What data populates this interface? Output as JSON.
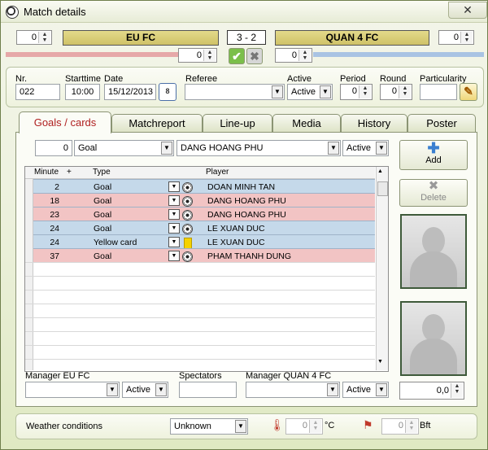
{
  "window": {
    "title": "Match details",
    "close_glyph": "✕"
  },
  "score": {
    "home_extra": "0",
    "home_team": "EU FC",
    "score_display": "3 - 2",
    "away_team": "QUAN 4 FC",
    "away_extra": "0",
    "home_goals": "0",
    "away_goals": "0"
  },
  "match_info": {
    "nr_label": "Nr.",
    "nr_value": "022",
    "starttime_label": "Starttime",
    "starttime_value": "10:00",
    "date_label": "Date",
    "date_value": "15/12/2013",
    "calendar_glyph": "8",
    "referee_label": "Referee",
    "referee_value": "",
    "active_label": "Active",
    "active_value": "Active",
    "period_label": "Period",
    "period_value": "0",
    "round_label": "Round",
    "round_value": "0",
    "particularity_label": "Particularity",
    "particularity_value": ""
  },
  "tabs": [
    "Goals / cards",
    "Matchreport",
    "Line-up",
    "Media",
    "History",
    "Poster"
  ],
  "goals": {
    "filter": {
      "minute": "0",
      "type": "Goal",
      "player": "DANG HOANG PHU",
      "status": "Active"
    },
    "headers": {
      "minute": "Minute",
      "plus": "+",
      "type": "Type",
      "player": "Player"
    },
    "rows": [
      {
        "minute": "2",
        "type": "Goal",
        "player": "DOAN MINH TAN",
        "team": "away",
        "icon": "ball-icon"
      },
      {
        "minute": "18",
        "type": "Goal",
        "player": "DANG HOANG PHU",
        "team": "home",
        "icon": "ball-icon"
      },
      {
        "minute": "23",
        "type": "Goal",
        "player": "DANG HOANG PHU",
        "team": "home",
        "icon": "ball-icon"
      },
      {
        "minute": "24",
        "type": "Goal",
        "player": "LE XUAN DUC",
        "team": "away",
        "icon": "ball-icon"
      },
      {
        "minute": "24",
        "type": "Yellow card",
        "player": "LE XUAN DUC",
        "team": "away",
        "icon": "yellow-card-icon"
      },
      {
        "minute": "37",
        "type": "Goal",
        "player": "PHAM THANH DUNG",
        "team": "home",
        "icon": "ball-icon"
      }
    ],
    "add_label": "Add",
    "delete_label": "Delete"
  },
  "bottom": {
    "manager_home_label": "Manager EU FC",
    "manager_home_value": "",
    "manager_home_status": "Active",
    "spectators_label": "Spectators",
    "spectators_value": "",
    "manager_away_label": "Manager QUAN 4 FC",
    "manager_away_value": "",
    "manager_away_status": "Active",
    "decimal_value": "0,0"
  },
  "weather": {
    "label": "Weather conditions",
    "condition": "Unknown",
    "temperature": "0",
    "temp_unit": "°C",
    "wind": "0",
    "wind_unit": "Bft"
  },
  "colors": {
    "home_row": "#f2c4c4",
    "away_row": "#c5d9ea",
    "team_bar": "#d9cf7a",
    "accent_tab": "#b02020"
  }
}
